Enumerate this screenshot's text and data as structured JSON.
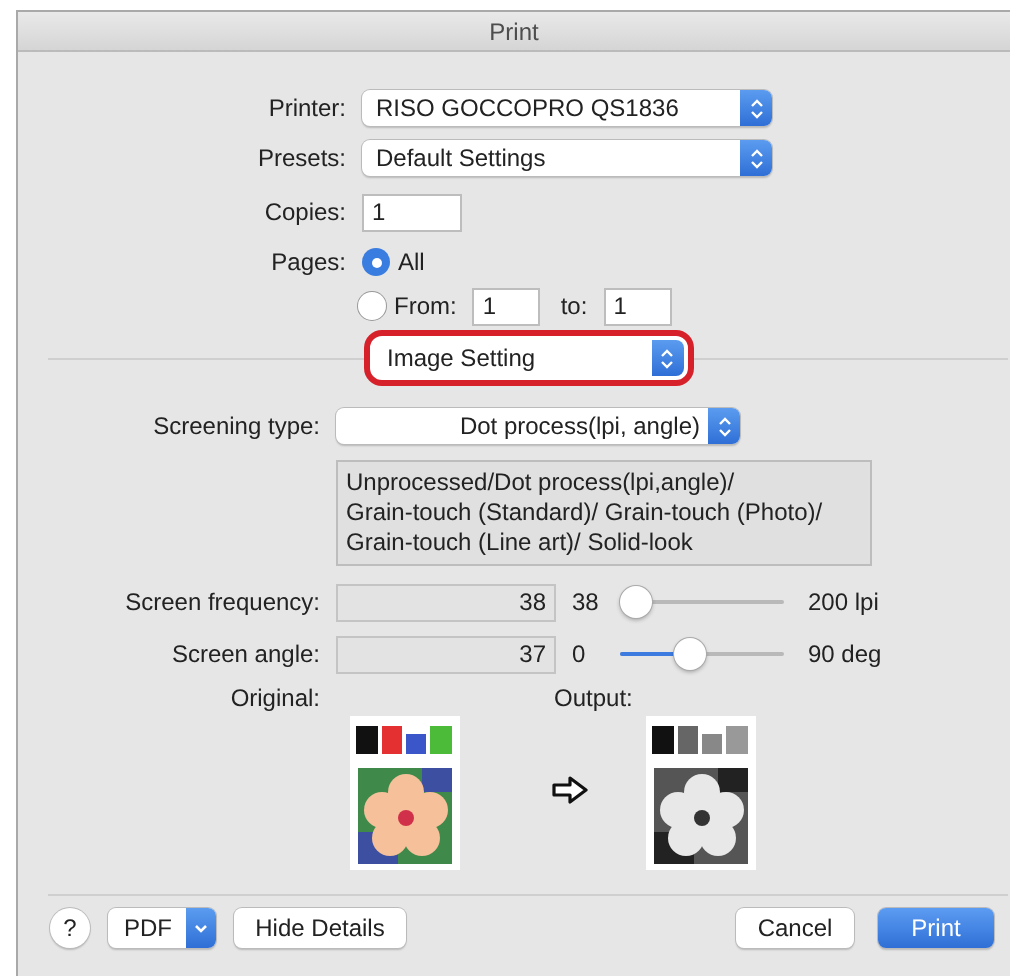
{
  "window": {
    "title": "Print"
  },
  "printer": {
    "label": "Printer:",
    "value": "RISO GOCCOPRO QS1836"
  },
  "presets": {
    "label": "Presets:",
    "value": "Default Settings"
  },
  "copies": {
    "label": "Copies:",
    "value": "1"
  },
  "pages": {
    "label": "Pages:",
    "options": [
      {
        "label": "All",
        "selected": true
      },
      {
        "label": "From:",
        "selected": false
      }
    ],
    "from": "1",
    "to_label": "to:",
    "to": "1"
  },
  "panel_menu": {
    "value": "Image Setting",
    "highlighted": true
  },
  "screening_type": {
    "label": "Screening type:",
    "value": "Dot process(lpi, angle)"
  },
  "info_lines": [
    "Unprocessed/Dot process(lpi,angle)/",
    "Grain-touch (Standard)/ Grain-touch (Photo)/",
    "Grain-touch (Line art)/ Solid-look"
  ],
  "sliders": [
    {
      "label": "Screen frequency:",
      "value": "38",
      "min": "38",
      "level": 0,
      "max": "200 lpi"
    },
    {
      "label": "Screen angle:",
      "value": "37",
      "min": "0",
      "level": 0.41,
      "max": "90 deg"
    }
  ],
  "preview": {
    "original_label": "Original:",
    "output_label": "Output:"
  },
  "footer": {
    "help": "?",
    "pdf": "PDF",
    "buttons": [
      {
        "label": "Hide Details",
        "default": false
      },
      {
        "label": "Cancel",
        "default": false
      },
      {
        "label": "Print",
        "default": true
      }
    ]
  }
}
